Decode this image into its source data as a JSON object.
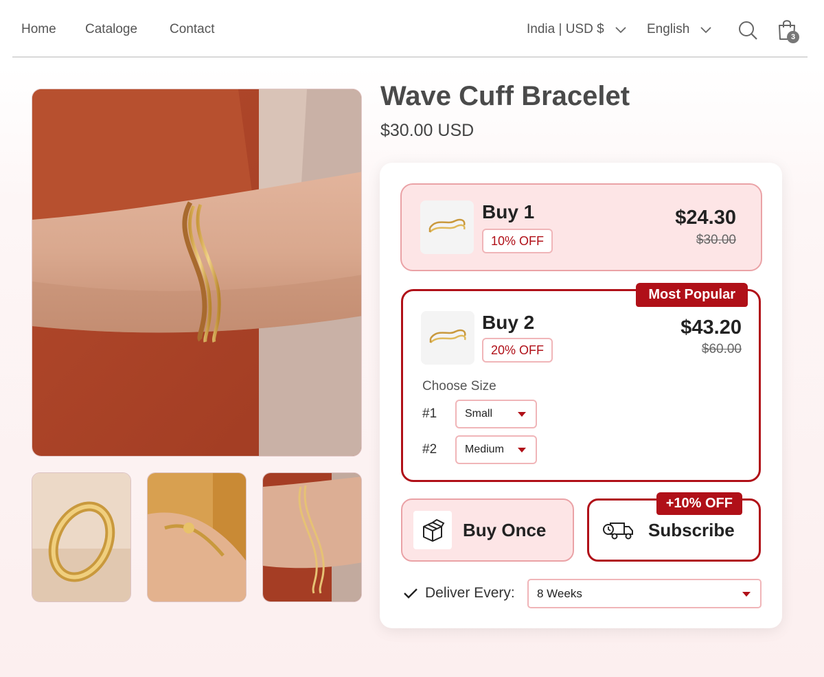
{
  "nav": {
    "links": [
      "Home",
      "Cataloge",
      "Contact"
    ],
    "region": "India | USD $",
    "language": "English",
    "cart_count": "3"
  },
  "product": {
    "title": "Wave Cuff Bracelet",
    "price": "$30.00 USD"
  },
  "bundles": [
    {
      "name": "Buy 1",
      "badge": "10% OFF",
      "price": "$24.30",
      "old_price": "$30.00",
      "selected": false
    },
    {
      "name": "Buy 2",
      "badge": "20% OFF",
      "price": "$43.20",
      "old_price": "$60.00",
      "tag": "Most Popular",
      "selected": true,
      "size_label": "Choose Size",
      "sizes": [
        {
          "num": "#1",
          "value": "Small"
        },
        {
          "num": "#2",
          "value": "Medium"
        }
      ]
    }
  ],
  "purchase": {
    "once_label": "Buy Once",
    "subscribe_label": "Subscribe",
    "subscribe_tag": "+10% OFF",
    "deliver_label": "Deliver Every:",
    "deliver_value": "8 Weeks"
  },
  "icons": [
    "chevron-down-icon",
    "search-icon",
    "shopping-bag-icon",
    "box-icon",
    "delivery-truck-icon",
    "check-icon",
    "caret-down-icon"
  ],
  "colors": {
    "accent": "#b01018",
    "accent_light": "#fde5e6",
    "border_light": "#eaa2a6"
  }
}
